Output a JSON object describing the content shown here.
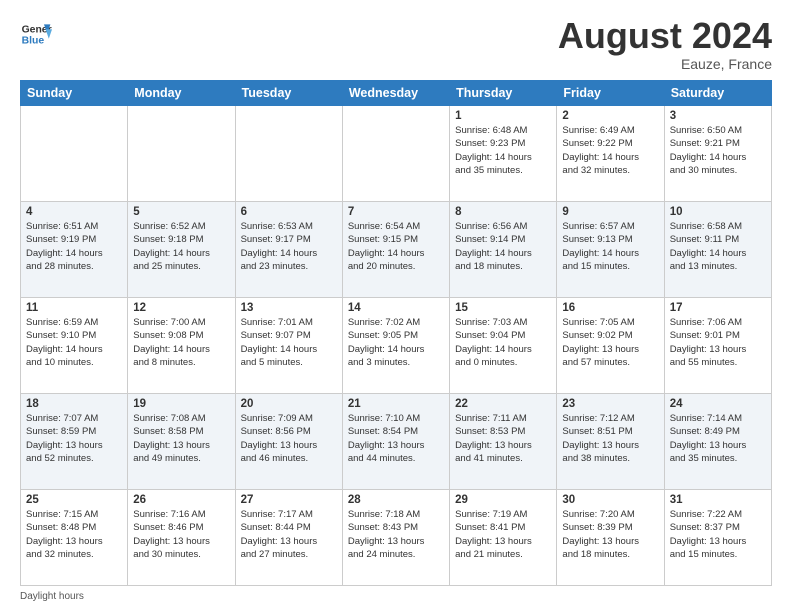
{
  "header": {
    "logo_line1": "General",
    "logo_line2": "Blue",
    "month_year": "August 2024",
    "location": "Eauze, France"
  },
  "footer": {
    "label": "Daylight hours"
  },
  "days_of_week": [
    "Sunday",
    "Monday",
    "Tuesday",
    "Wednesday",
    "Thursday",
    "Friday",
    "Saturday"
  ],
  "weeks": [
    [
      {
        "day": "",
        "info": ""
      },
      {
        "day": "",
        "info": ""
      },
      {
        "day": "",
        "info": ""
      },
      {
        "day": "",
        "info": ""
      },
      {
        "day": "1",
        "info": "Sunrise: 6:48 AM\nSunset: 9:23 PM\nDaylight: 14 hours\nand 35 minutes."
      },
      {
        "day": "2",
        "info": "Sunrise: 6:49 AM\nSunset: 9:22 PM\nDaylight: 14 hours\nand 32 minutes."
      },
      {
        "day": "3",
        "info": "Sunrise: 6:50 AM\nSunset: 9:21 PM\nDaylight: 14 hours\nand 30 minutes."
      }
    ],
    [
      {
        "day": "4",
        "info": "Sunrise: 6:51 AM\nSunset: 9:19 PM\nDaylight: 14 hours\nand 28 minutes."
      },
      {
        "day": "5",
        "info": "Sunrise: 6:52 AM\nSunset: 9:18 PM\nDaylight: 14 hours\nand 25 minutes."
      },
      {
        "day": "6",
        "info": "Sunrise: 6:53 AM\nSunset: 9:17 PM\nDaylight: 14 hours\nand 23 minutes."
      },
      {
        "day": "7",
        "info": "Sunrise: 6:54 AM\nSunset: 9:15 PM\nDaylight: 14 hours\nand 20 minutes."
      },
      {
        "day": "8",
        "info": "Sunrise: 6:56 AM\nSunset: 9:14 PM\nDaylight: 14 hours\nand 18 minutes."
      },
      {
        "day": "9",
        "info": "Sunrise: 6:57 AM\nSunset: 9:13 PM\nDaylight: 14 hours\nand 15 minutes."
      },
      {
        "day": "10",
        "info": "Sunrise: 6:58 AM\nSunset: 9:11 PM\nDaylight: 14 hours\nand 13 minutes."
      }
    ],
    [
      {
        "day": "11",
        "info": "Sunrise: 6:59 AM\nSunset: 9:10 PM\nDaylight: 14 hours\nand 10 minutes."
      },
      {
        "day": "12",
        "info": "Sunrise: 7:00 AM\nSunset: 9:08 PM\nDaylight: 14 hours\nand 8 minutes."
      },
      {
        "day": "13",
        "info": "Sunrise: 7:01 AM\nSunset: 9:07 PM\nDaylight: 14 hours\nand 5 minutes."
      },
      {
        "day": "14",
        "info": "Sunrise: 7:02 AM\nSunset: 9:05 PM\nDaylight: 14 hours\nand 3 minutes."
      },
      {
        "day": "15",
        "info": "Sunrise: 7:03 AM\nSunset: 9:04 PM\nDaylight: 14 hours\nand 0 minutes."
      },
      {
        "day": "16",
        "info": "Sunrise: 7:05 AM\nSunset: 9:02 PM\nDaylight: 13 hours\nand 57 minutes."
      },
      {
        "day": "17",
        "info": "Sunrise: 7:06 AM\nSunset: 9:01 PM\nDaylight: 13 hours\nand 55 minutes."
      }
    ],
    [
      {
        "day": "18",
        "info": "Sunrise: 7:07 AM\nSunset: 8:59 PM\nDaylight: 13 hours\nand 52 minutes."
      },
      {
        "day": "19",
        "info": "Sunrise: 7:08 AM\nSunset: 8:58 PM\nDaylight: 13 hours\nand 49 minutes."
      },
      {
        "day": "20",
        "info": "Sunrise: 7:09 AM\nSunset: 8:56 PM\nDaylight: 13 hours\nand 46 minutes."
      },
      {
        "day": "21",
        "info": "Sunrise: 7:10 AM\nSunset: 8:54 PM\nDaylight: 13 hours\nand 44 minutes."
      },
      {
        "day": "22",
        "info": "Sunrise: 7:11 AM\nSunset: 8:53 PM\nDaylight: 13 hours\nand 41 minutes."
      },
      {
        "day": "23",
        "info": "Sunrise: 7:12 AM\nSunset: 8:51 PM\nDaylight: 13 hours\nand 38 minutes."
      },
      {
        "day": "24",
        "info": "Sunrise: 7:14 AM\nSunset: 8:49 PM\nDaylight: 13 hours\nand 35 minutes."
      }
    ],
    [
      {
        "day": "25",
        "info": "Sunrise: 7:15 AM\nSunset: 8:48 PM\nDaylight: 13 hours\nand 32 minutes."
      },
      {
        "day": "26",
        "info": "Sunrise: 7:16 AM\nSunset: 8:46 PM\nDaylight: 13 hours\nand 30 minutes."
      },
      {
        "day": "27",
        "info": "Sunrise: 7:17 AM\nSunset: 8:44 PM\nDaylight: 13 hours\nand 27 minutes."
      },
      {
        "day": "28",
        "info": "Sunrise: 7:18 AM\nSunset: 8:43 PM\nDaylight: 13 hours\nand 24 minutes."
      },
      {
        "day": "29",
        "info": "Sunrise: 7:19 AM\nSunset: 8:41 PM\nDaylight: 13 hours\nand 21 minutes."
      },
      {
        "day": "30",
        "info": "Sunrise: 7:20 AM\nSunset: 8:39 PM\nDaylight: 13 hours\nand 18 minutes."
      },
      {
        "day": "31",
        "info": "Sunrise: 7:22 AM\nSunset: 8:37 PM\nDaylight: 13 hours\nand 15 minutes."
      }
    ]
  ]
}
